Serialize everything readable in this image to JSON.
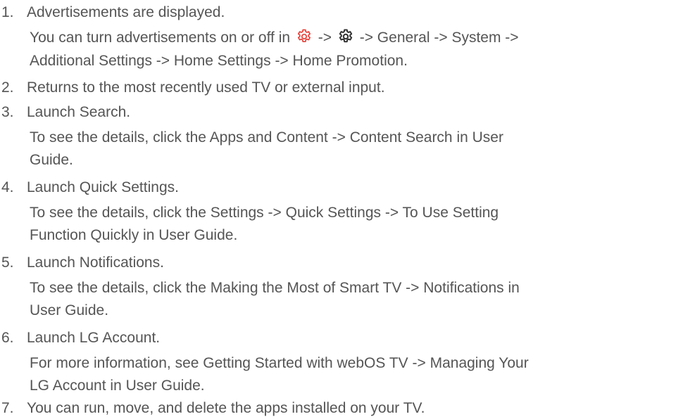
{
  "colors": {
    "text": "#555555",
    "accent": "#e8413a",
    "icon_dark": "#333333"
  },
  "icons": {
    "settings_red": "gear-icon",
    "settings_dark": "gear-icon"
  },
  "items": [
    {
      "number": "1.",
      "title": "Advertisements are displayed.",
      "detail_before_icons": "You can turn advertisements on or off in",
      "arrow_1": "->",
      "detail_after_icons": "-> General -> System ->",
      "detail_line_2": "Additional Settings -> Home Settings -> Home Promotion."
    },
    {
      "number": "2.",
      "title": "Returns to the most recently used TV or external input."
    },
    {
      "number": "3.",
      "title": "Launch Search.",
      "detail_line_1": "To see the details, click the Apps and Content -> Content Search in User",
      "detail_line_2": "Guide."
    },
    {
      "number": "4.",
      "title": "Launch Quick Settings.",
      "detail_line_1": "To see the details, click the Settings -> Quick Settings -> To Use Setting",
      "detail_line_2": "Function Quickly in User Guide."
    },
    {
      "number": "5.",
      "title": "Launch Notifications.",
      "detail_line_1": "To see the details, click the Making the Most of Smart TV -> Notifications in",
      "detail_line_2": "User Guide."
    },
    {
      "number": "6.",
      "title": "Launch LG Account.",
      "detail_line_1": "For more information, see Getting Started with webOS TV -> Managing Your",
      "detail_line_2": "LG Account in User Guide."
    },
    {
      "number": "7.",
      "title": "You can run, move, and delete the apps installed on your TV."
    }
  ]
}
